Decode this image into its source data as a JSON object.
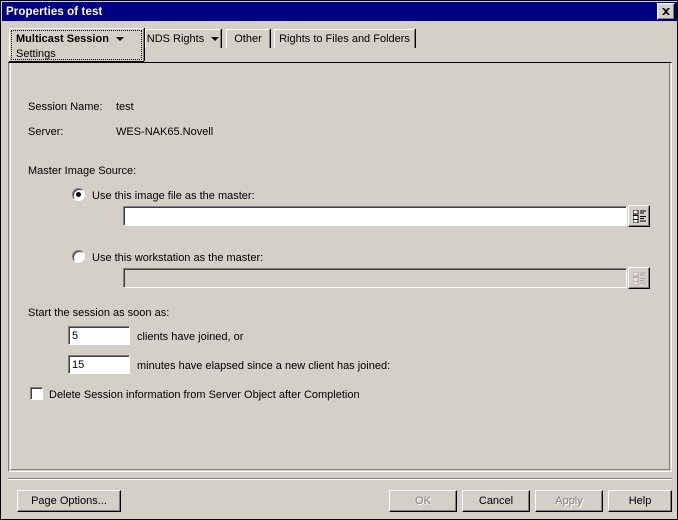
{
  "window": {
    "title": "Properties of test",
    "close_icon": "close-icon"
  },
  "tabs": [
    {
      "label": "Multicast Session",
      "sublabel": "Settings",
      "has_caret": true,
      "active": true
    },
    {
      "label": "NDS Rights",
      "has_caret": true,
      "active": false
    },
    {
      "label": "Other",
      "has_caret": false,
      "active": false
    },
    {
      "label": "Rights to Files and Folders",
      "has_caret": false,
      "active": false
    }
  ],
  "form": {
    "session_name_label": "Session Name:",
    "session_name_value": "test",
    "server_label": "Server:",
    "server_value": "WES-NAK65.Novell",
    "master_image_source_label": "Master Image Source:",
    "radio_image_file_label": "Use this image file as the master:",
    "image_file_value": "",
    "image_file_browse_icon": "tree-browse-icon",
    "radio_workstation_label": "Use this workstation as the master:",
    "workstation_value": "",
    "workstation_browse_icon": "tree-browse-icon",
    "start_session_label": "Start the session as soon as:",
    "clients_value": "5",
    "clients_suffix_label": "clients have joined, or",
    "minutes_value": "15",
    "minutes_suffix_label": "minutes have elapsed since a new client has joined:",
    "delete_session_label": "Delete Session information from Server Object after Completion"
  },
  "footer": {
    "page_options_label": "Page Options...",
    "ok_label": "OK",
    "cancel_label": "Cancel",
    "apply_label": "Apply",
    "help_label": "Help"
  },
  "colors": {
    "titlebar": "#000080",
    "face": "#d4d0c8",
    "field": "#ffffff",
    "disabled_text": "#808080"
  }
}
